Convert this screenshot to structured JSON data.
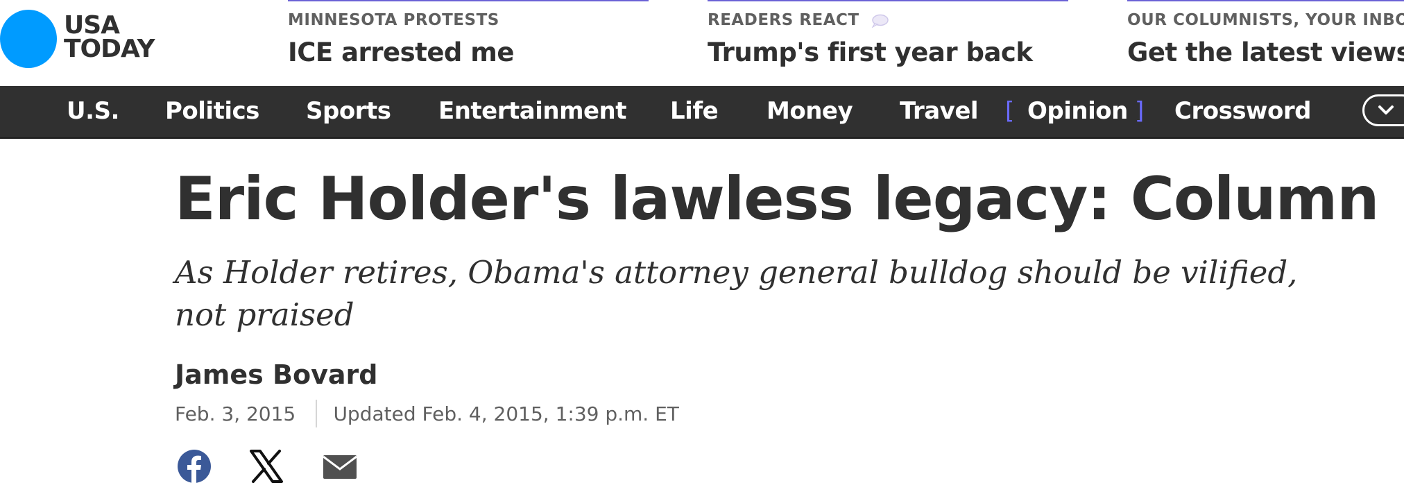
{
  "brand": {
    "logo_line1": "USA",
    "logo_line2": "TODAY",
    "accent_color": "#009bff"
  },
  "promos": [
    {
      "kicker": "MINNESOTA PROTESTS",
      "headline": "ICE arrested me"
    },
    {
      "kicker": "READERS REACT",
      "headline": "Trump's first year back",
      "icon": "speech-bubble-icon"
    },
    {
      "kicker": "OUR COLUMNISTS, YOUR INBO",
      "headline": "Get the latest views"
    }
  ],
  "nav": {
    "items": [
      {
        "label": "U.S."
      },
      {
        "label": "Politics"
      },
      {
        "label": "Sports"
      },
      {
        "label": "Entertainment"
      },
      {
        "label": "Life"
      },
      {
        "label": "Money"
      },
      {
        "label": "Travel"
      },
      {
        "label": "Opinion",
        "bracket_open": "[",
        "bracket_close": "]"
      },
      {
        "label": "Crossword"
      }
    ],
    "more_icon": "chevron-down-icon"
  },
  "article": {
    "headline": "Eric Holder's lawless legacy: Column",
    "dek": "As Holder retires, Obama's attorney general bulldog should be vilified, not praised",
    "author": "James Bovard",
    "published": "Feb. 3, 2015",
    "updated": "Updated Feb. 4, 2015, 1:39 p.m. ET"
  },
  "share": [
    {
      "icon": "facebook-icon",
      "color": "#3b5998"
    },
    {
      "icon": "x-icon",
      "color": "#111111"
    },
    {
      "icon": "email-icon",
      "color": "#505050"
    }
  ]
}
